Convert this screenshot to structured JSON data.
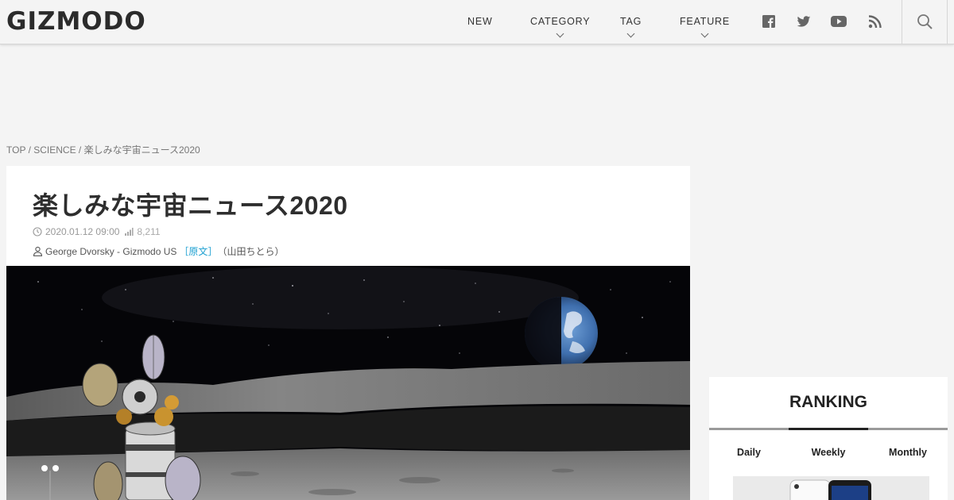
{
  "header": {
    "logo": "GIZMODO",
    "nav": [
      {
        "label": "NEW"
      },
      {
        "label": "CATEGORY"
      },
      {
        "label": "TAG"
      },
      {
        "label": "FEATURE"
      }
    ],
    "social_icons": [
      "facebook-icon",
      "twitter-icon",
      "youtube-icon",
      "rss-icon"
    ],
    "search_icon": "search-icon"
  },
  "breadcrumb": {
    "items": [
      "TOP",
      "SCIENCE",
      "楽しみな宇宙ニュース2020"
    ],
    "separator": " / "
  },
  "article": {
    "title": "楽しみな宇宙ニュース2020",
    "date": "2020.01.12 09:00",
    "views": "8,211",
    "author": "George Dvorsky - Gizmodo US",
    "original_label": "原文",
    "translator": "山田ちとら"
  },
  "ranking": {
    "title": "RANKING",
    "tabs": [
      "Daily",
      "Weekly",
      "Monthly"
    ],
    "active_tab": "Weekly"
  },
  "colors": {
    "background": "#f4f4f4",
    "link_accent": "#1a9fd0",
    "text_dark": "#2e2e2e"
  }
}
